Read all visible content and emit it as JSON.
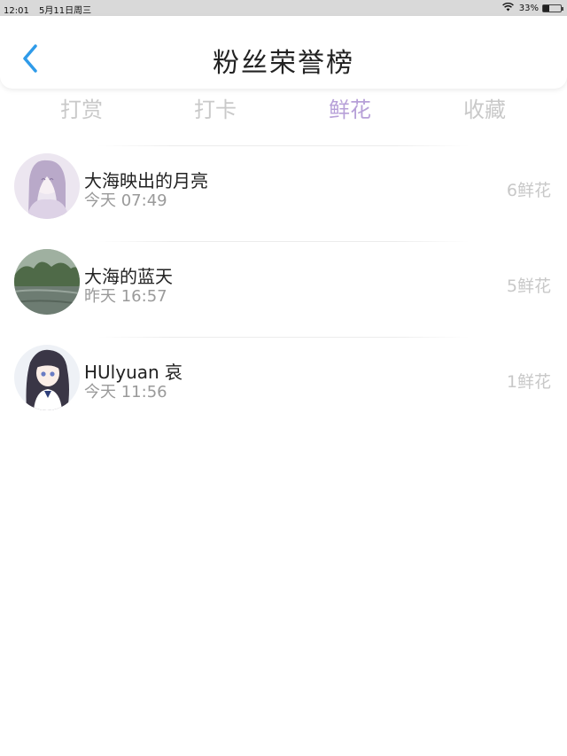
{
  "status_bar": {
    "time": "12:01",
    "date": "5月11日周三",
    "battery": "33%",
    "battery_level": 0.33,
    "wifi_icon": "wifi-icon",
    "battery_icon": "battery-icon"
  },
  "header": {
    "title": "粉丝荣誉榜",
    "back_icon": "chevron-left-icon",
    "accent_color": "#2f9be9"
  },
  "tabs": [
    {
      "label": "打赏",
      "active": false
    },
    {
      "label": "打卡",
      "active": false
    },
    {
      "label": "鲜花",
      "active": true
    },
    {
      "label": "收藏",
      "active": false
    }
  ],
  "tab_active_color": "#b7a0d8",
  "fans": [
    {
      "name": "大海映出的月亮",
      "time": "今天 07:49",
      "count": "6鲜花"
    },
    {
      "name": "大海的蓝天",
      "time": "昨天 16:57",
      "count": "5鲜花"
    },
    {
      "name": "HUlyuan 哀",
      "time": "今天 11:56",
      "count": "1鲜花"
    }
  ]
}
